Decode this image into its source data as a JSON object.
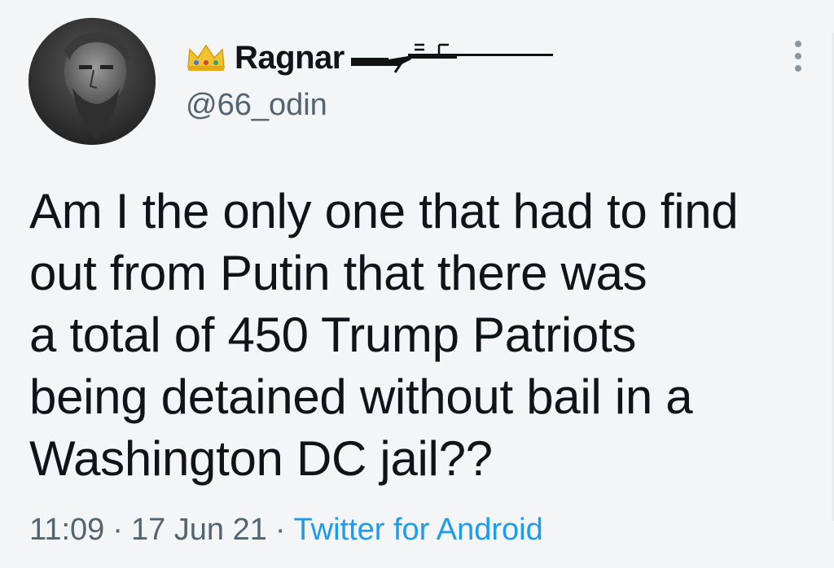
{
  "tweet": {
    "author": {
      "display_name": "Ragnar",
      "handle": "@66_odin",
      "badge_icon": "crown-icon",
      "flair_icon": "rifle-icon",
      "avatar_icon": "bearded-man-avatar"
    },
    "more_icon": "more-vertical-icon",
    "text": "Am I the only one that had to find\nout from Putin that there was\na total of 450 Trump Patriots\nbeing detained without bail in a\nWashington DC jail??",
    "time": "11:09",
    "separator": "·",
    "date": "17 Jun 21",
    "source": "Twitter for Android"
  },
  "colors": {
    "background": "#f4f5f6",
    "text": "#0f1419",
    "secondary": "#536471",
    "link": "#1d9bf0",
    "crown": "#f2c230"
  }
}
